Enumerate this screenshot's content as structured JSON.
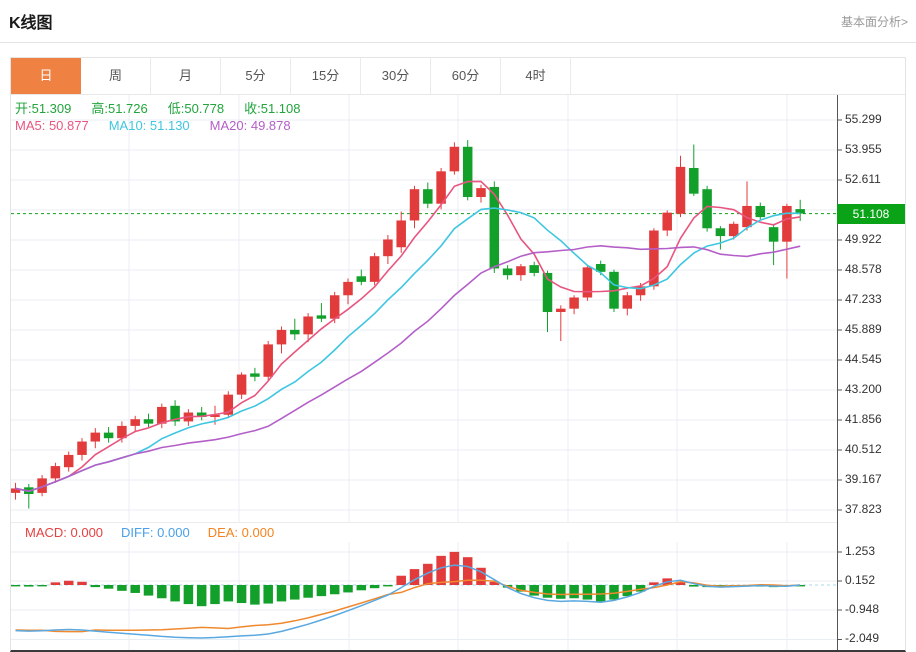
{
  "page": {
    "title": "K线图",
    "link": "基本面分析>"
  },
  "tabs": {
    "items": [
      "日",
      "周",
      "月",
      "5分",
      "15分",
      "30分",
      "60分",
      "4时"
    ],
    "active": "日"
  },
  "legend": {
    "ohlc": [
      {
        "label": "开:",
        "value": "51.309"
      },
      {
        "label": "高:",
        "value": "51.726"
      },
      {
        "label": "低:",
        "value": "50.778"
      },
      {
        "label": "收:",
        "value": "51.108"
      }
    ],
    "ma": [
      {
        "label": "MA5:",
        "value": "50.877",
        "color": "#e8557f"
      },
      {
        "label": "MA10:",
        "value": "51.130",
        "color": "#3fc6e0"
      },
      {
        "label": "MA20:",
        "value": "49.878",
        "color": "#b45fc8"
      }
    ],
    "macd": [
      {
        "label": "MACD:",
        "value": "0.000",
        "color": "#e64141"
      },
      {
        "label": "DIFF:",
        "value": "0.000",
        "color": "#4a9fe8"
      },
      {
        "label": "DEA:",
        "value": "0.000",
        "color": "#f5831f"
      }
    ]
  },
  "price_tag": "51.108",
  "colors": {
    "up": "#e23b3b",
    "down": "#12a02b",
    "ohlc_text": "#21a53c",
    "ma5": "#e8557f",
    "ma10": "#3fc6e0",
    "ma20": "#b45fc8",
    "grid": "#e8eef5",
    "dashed_price": "#0fa31c",
    "tag_bg": "#0aa318",
    "diff_line": "#5aa8e0",
    "dea_line": "#f0882e",
    "zero_dash": "#a8d8ec",
    "axis_text": "#333333",
    "tab_active_bg": "#ef8143"
  },
  "chart_data": {
    "type": "candlestick+macd",
    "title": "K线图 daily candles with MA5/MA10/MA20 overlays and MACD panel",
    "main": {
      "axis_labels": [
        "55.299",
        "53.955",
        "52.611",
        "49.922",
        "48.578",
        "47.233",
        "45.889",
        "44.545",
        "43.200",
        "41.856",
        "40.512",
        "39.167",
        "37.823"
      ],
      "hidden_grid_value": 51.267,
      "last_close": 51.108,
      "ma_periods": [
        5,
        10,
        20
      ],
      "candles": [
        [
          38.6,
          39.05,
          38.3,
          38.8
        ],
        [
          38.85,
          39.0,
          37.9,
          38.55
        ],
        [
          38.6,
          39.4,
          38.45,
          39.25
        ],
        [
          39.25,
          39.95,
          39.05,
          39.8
        ],
        [
          39.75,
          40.45,
          39.55,
          40.3
        ],
        [
          40.3,
          41.05,
          40.05,
          40.9
        ],
        [
          40.9,
          41.5,
          40.6,
          41.3
        ],
        [
          41.3,
          41.55,
          40.85,
          41.05
        ],
        [
          41.05,
          41.8,
          40.85,
          41.6
        ],
        [
          41.6,
          42.05,
          41.35,
          41.9
        ],
        [
          41.9,
          42.15,
          41.55,
          41.7
        ],
        [
          41.7,
          42.6,
          41.5,
          42.45
        ],
        [
          42.5,
          42.75,
          41.6,
          41.8
        ],
        [
          41.8,
          42.35,
          41.6,
          42.2
        ],
        [
          42.2,
          42.45,
          41.85,
          42.0
        ],
        [
          42.0,
          42.5,
          41.65,
          42.1
        ],
        [
          42.1,
          43.15,
          41.95,
          43.0
        ],
        [
          43.0,
          44.0,
          42.8,
          43.9
        ],
        [
          43.95,
          44.2,
          43.6,
          43.8
        ],
        [
          43.8,
          45.4,
          43.65,
          45.25
        ],
        [
          45.25,
          46.05,
          44.85,
          45.9
        ],
        [
          45.9,
          46.4,
          45.45,
          45.7
        ],
        [
          45.7,
          46.65,
          45.35,
          46.5
        ],
        [
          46.55,
          47.1,
          46.25,
          46.4
        ],
        [
          46.4,
          47.6,
          46.2,
          47.45
        ],
        [
          47.45,
          48.2,
          47.05,
          48.05
        ],
        [
          48.3,
          48.6,
          47.9,
          48.05
        ],
        [
          48.05,
          49.35,
          47.9,
          49.2
        ],
        [
          49.2,
          50.15,
          48.85,
          49.95
        ],
        [
          49.6,
          51.2,
          49.35,
          50.8
        ],
        [
          50.8,
          52.35,
          50.45,
          52.2
        ],
        [
          52.2,
          52.5,
          51.35,
          51.55
        ],
        [
          51.55,
          53.15,
          51.3,
          53.0
        ],
        [
          53.0,
          54.3,
          52.85,
          54.1
        ],
        [
          54.1,
          54.4,
          51.7,
          51.85
        ],
        [
          51.85,
          52.4,
          51.6,
          52.25
        ],
        [
          52.3,
          52.55,
          48.45,
          48.65
        ],
        [
          48.65,
          48.8,
          48.15,
          48.35
        ],
        [
          48.35,
          48.85,
          48.1,
          48.75
        ],
        [
          48.8,
          48.95,
          48.3,
          48.45
        ],
        [
          48.45,
          48.55,
          45.8,
          46.7
        ],
        [
          46.7,
          47.0,
          45.4,
          46.85
        ],
        [
          46.85,
          47.45,
          46.6,
          47.35
        ],
        [
          47.35,
          48.8,
          47.2,
          48.7
        ],
        [
          48.85,
          49.0,
          48.35,
          48.5
        ],
        [
          48.5,
          48.6,
          46.7,
          46.85
        ],
        [
          46.85,
          47.6,
          46.55,
          47.45
        ],
        [
          47.45,
          48.0,
          47.2,
          47.85
        ],
        [
          47.85,
          50.45,
          47.7,
          50.35
        ],
        [
          50.35,
          51.25,
          50.1,
          51.15
        ],
        [
          51.1,
          53.7,
          50.95,
          53.2
        ],
        [
          53.15,
          54.2,
          51.9,
          52.0
        ],
        [
          52.2,
          52.35,
          50.3,
          50.45
        ],
        [
          50.45,
          50.55,
          49.5,
          50.1
        ],
        [
          50.1,
          50.75,
          49.95,
          50.65
        ],
        [
          50.5,
          52.55,
          50.35,
          51.45
        ],
        [
          51.45,
          51.6,
          50.85,
          50.95
        ],
        [
          50.5,
          50.65,
          48.8,
          49.85
        ],
        [
          49.85,
          51.55,
          48.2,
          51.45
        ],
        [
          51.309,
          51.726,
          50.778,
          51.108
        ]
      ]
    },
    "macd": {
      "axis_labels": [
        "1.253",
        "0.152",
        "-0.948",
        "-2.049"
      ],
      "hist": [
        -0.05,
        -0.06,
        -0.04,
        0.1,
        0.16,
        0.12,
        -0.08,
        -0.14,
        -0.22,
        -0.3,
        -0.4,
        -0.5,
        -0.62,
        -0.72,
        -0.8,
        -0.72,
        -0.62,
        -0.68,
        -0.74,
        -0.7,
        -0.62,
        -0.55,
        -0.48,
        -0.42,
        -0.35,
        -0.28,
        -0.2,
        -0.12,
        -0.05,
        0.35,
        0.6,
        0.8,
        1.1,
        1.25,
        1.05,
        0.65,
        0.12,
        -0.1,
        -0.25,
        -0.4,
        -0.48,
        -0.52,
        -0.5,
        -0.55,
        -0.62,
        -0.55,
        -0.42,
        -0.25,
        0.1,
        0.25,
        0.12,
        -0.06,
        -0.08,
        -0.06,
        -0.07,
        -0.05,
        -0.06,
        -0.08,
        -0.05,
        -0.04
      ],
      "diff": [
        -1.72,
        -1.74,
        -1.73,
        -1.7,
        -1.68,
        -1.7,
        -1.74,
        -1.78,
        -1.82,
        -1.86,
        -1.9,
        -1.94,
        -1.97,
        -1.99,
        -2.0,
        -1.98,
        -1.95,
        -1.92,
        -1.9,
        -1.85,
        -1.75,
        -1.62,
        -1.48,
        -1.32,
        -1.15,
        -0.97,
        -0.78,
        -0.58,
        -0.38,
        -0.1,
        0.2,
        0.45,
        0.65,
        0.75,
        0.7,
        0.5,
        0.2,
        -0.1,
        -0.32,
        -0.48,
        -0.58,
        -0.62,
        -0.6,
        -0.62,
        -0.65,
        -0.58,
        -0.45,
        -0.28,
        -0.05,
        0.12,
        0.18,
        0.05,
        -0.05,
        -0.08,
        -0.06,
        -0.04,
        -0.02,
        -0.04,
        -0.05,
        0.0
      ],
      "dea": [
        -1.7,
        -1.71,
        -1.71,
        -1.75,
        -1.76,
        -1.76,
        -1.7,
        -1.71,
        -1.71,
        -1.71,
        -1.7,
        -1.69,
        -1.66,
        -1.63,
        -1.6,
        -1.62,
        -1.64,
        -1.58,
        -1.53,
        -1.5,
        -1.44,
        -1.35,
        -1.24,
        -1.11,
        -0.98,
        -0.83,
        -0.68,
        -0.52,
        -0.36,
        -0.28,
        -0.1,
        0.05,
        0.1,
        0.13,
        0.18,
        0.18,
        0.14,
        -0.05,
        -0.2,
        -0.28,
        -0.34,
        -0.36,
        -0.35,
        -0.35,
        -0.34,
        -0.31,
        -0.24,
        -0.16,
        -0.1,
        0.0,
        0.12,
        0.08,
        -0.01,
        -0.05,
        -0.03,
        -0.02,
        0.01,
        0.0,
        -0.03,
        0.0
      ]
    }
  }
}
